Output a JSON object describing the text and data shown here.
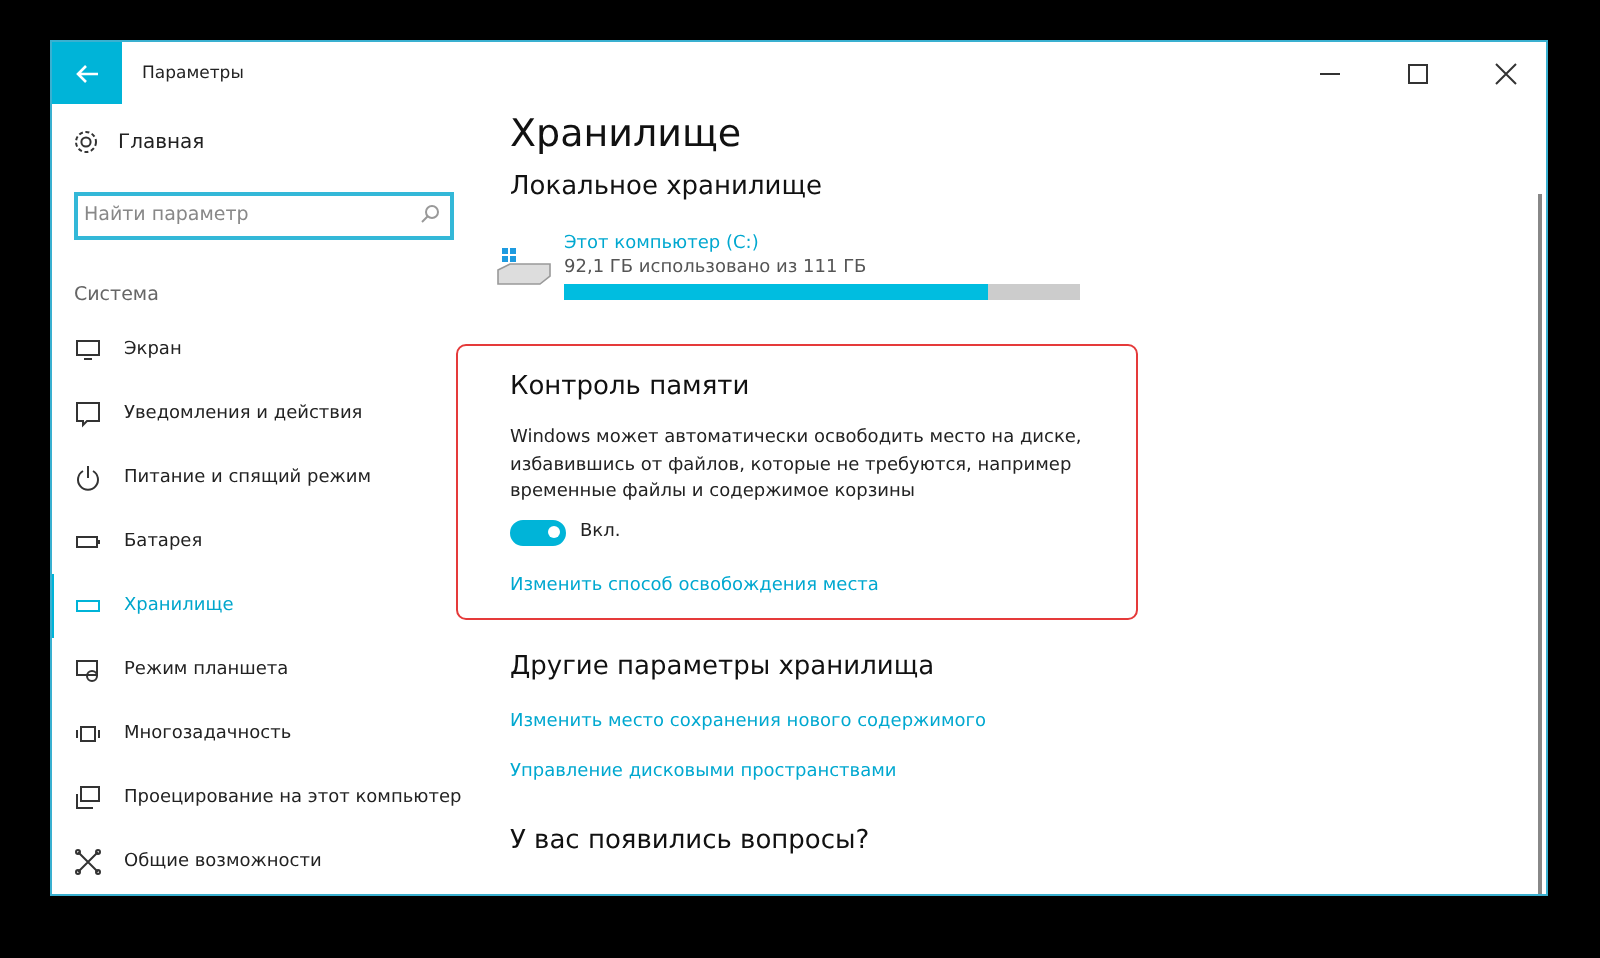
{
  "window": {
    "title": "Параметры"
  },
  "sidebar": {
    "home": "Главная",
    "search": {
      "placeholder": "Найти параметр"
    },
    "section": "Система",
    "items": [
      {
        "label": "Экран",
        "selected": false
      },
      {
        "label": "Уведомления и действия",
        "selected": false
      },
      {
        "label": "Питание и спящий режим",
        "selected": false
      },
      {
        "label": "Батарея",
        "selected": false
      },
      {
        "label": "Хранилище",
        "selected": true
      },
      {
        "label": "Режим планшета",
        "selected": false
      },
      {
        "label": "Многозадачность",
        "selected": false
      },
      {
        "label": "Проецирование на этот компьютер",
        "selected": false
      },
      {
        "label": "Общие возможности",
        "selected": false
      }
    ]
  },
  "content": {
    "title": "Хранилище",
    "local_heading": "Локальное хранилище",
    "drive": {
      "name": "Этот компьютер (C:)",
      "usage": "92,1 ГБ использовано из 111 ГБ",
      "level": 0.82
    },
    "storage_sense": {
      "title": "Контроль памяти",
      "description": "Windows может автоматически освободить место на диске, избавившись от файлов, которые не требуются, например временные файлы и содержимое корзины",
      "on": true,
      "toggle_label": "Вкл.",
      "link": "Изменить способ освобождения места"
    },
    "other_heading": "Другие параметры хранилища",
    "links": [
      "Изменить место сохранения нового содержимого",
      "Управление дисковыми пространствами"
    ],
    "questions_heading": "У вас появились вопросы?"
  }
}
